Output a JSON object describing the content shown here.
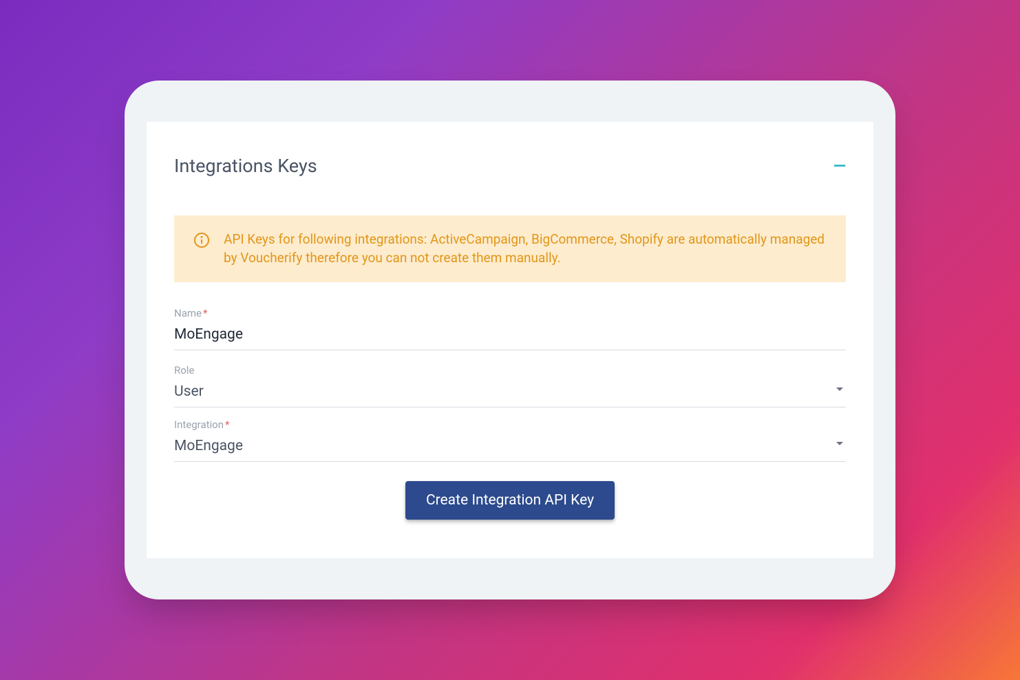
{
  "header": {
    "title": "Integrations Keys"
  },
  "banner": {
    "message": "API Keys for following integrations: ActiveCampaign, BigCommerce, Shopify are automatically managed by Voucherify therefore you can not create them manually."
  },
  "form": {
    "name_label": "Name",
    "name_value": "MoEngage",
    "role_label": "Role",
    "role_value": "User",
    "integration_label": "Integration",
    "integration_value": "MoEngage",
    "required_mark": "*"
  },
  "actions": {
    "create_button_label": "Create Integration API Key"
  }
}
